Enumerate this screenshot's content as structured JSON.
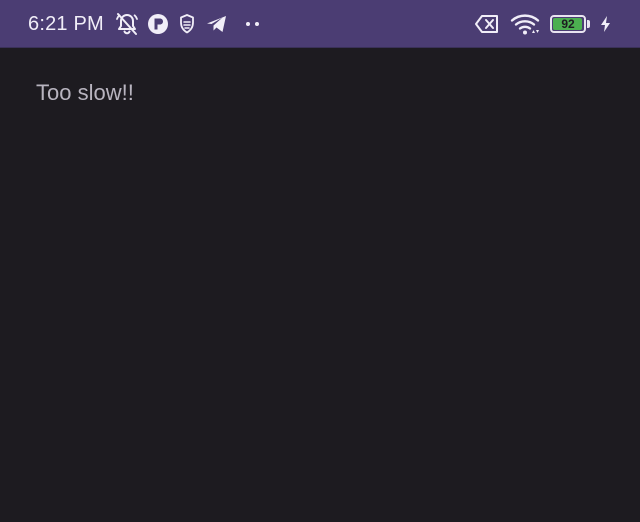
{
  "status_bar": {
    "time": "6:21 PM",
    "notification_icons": [
      "bell-off-icon",
      "r-app-icon",
      "shield-app-icon",
      "telegram-icon",
      "more-dots-icon"
    ],
    "system_icons": [
      "no-sim-icon",
      "wifi-icon",
      "battery-icon",
      "charging-icon"
    ],
    "battery_level": "92",
    "battery_percent": 92,
    "background_color": "#4b3d73",
    "battery_color": "#4caf50"
  },
  "main": {
    "message": "Too slow!!",
    "background_color": "#1d1b20"
  }
}
